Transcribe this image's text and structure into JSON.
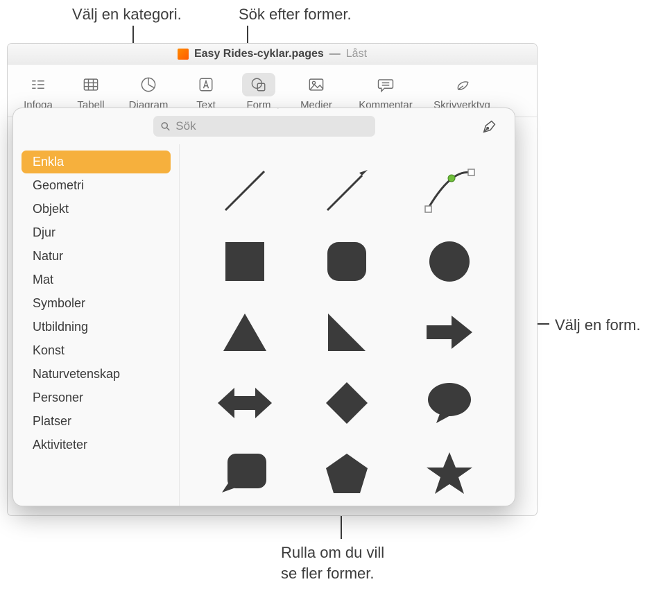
{
  "callouts": {
    "category": "Välj en kategori.",
    "search": "Sök efter former.",
    "select_shape": "Välj en form.",
    "scroll": "Rulla om du vill\nse fler former."
  },
  "window": {
    "document_name": "Easy Rides-cyklar.pages",
    "separator": "—",
    "status": "Låst"
  },
  "toolbar": {
    "insert": "Infoga",
    "table": "Tabell",
    "chart": "Diagram",
    "text": "Text",
    "shape": "Form",
    "media": "Medier",
    "comment": "Kommentar",
    "author": "Skrivverktyg"
  },
  "popover": {
    "search_placeholder": "Sök",
    "categories": [
      "Enkla",
      "Geometri",
      "Objekt",
      "Djur",
      "Natur",
      "Mat",
      "Symboler",
      "Utbildning",
      "Konst",
      "Naturvetenskap",
      "Personer",
      "Platser",
      "Aktiviteter"
    ],
    "selected_index": 0,
    "shapes": [
      "line",
      "arrow-line",
      "curve",
      "square",
      "rounded-square",
      "circle",
      "triangle",
      "right-triangle",
      "arrow-right",
      "double-arrow",
      "diamond",
      "speech-bubble",
      "callout-box",
      "pentagon",
      "star"
    ]
  }
}
